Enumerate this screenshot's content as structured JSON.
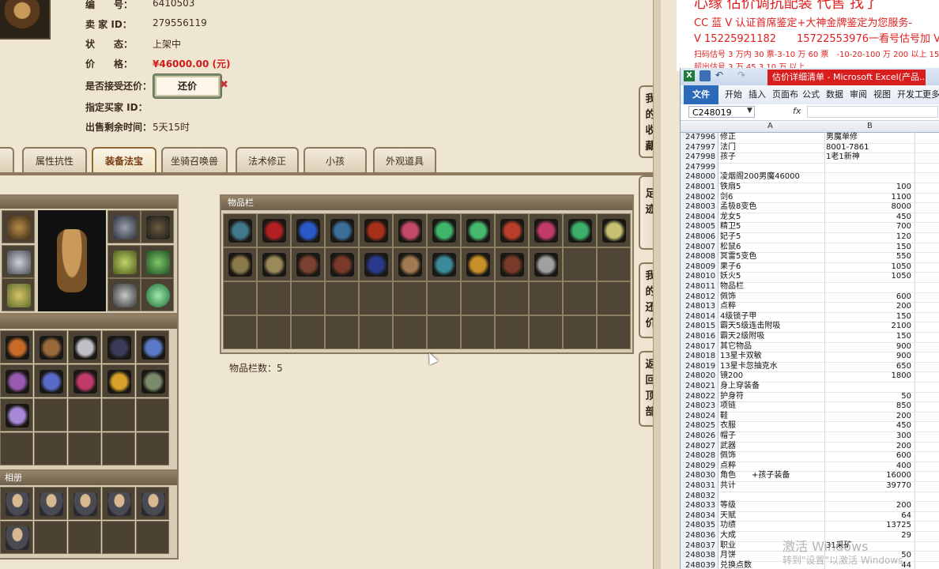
{
  "listing": {
    "id_label": "编　　号：",
    "id_value": "6410503",
    "seller_label": "卖 家 ID：",
    "seller_value": "279556119",
    "status_label": "状　　态：",
    "status_value": "上架中",
    "price_label": "价　　格：",
    "price_value": "¥46000.00 (元)",
    "counter_label": "是否接受还价：",
    "counter_button": "还价",
    "buyer_label": "指定买家 ID：",
    "remaining_label": "出售剩余时间：",
    "remaining_value": "5天15时"
  },
  "tabs": [
    "息",
    "属性抗性",
    "装备法宝",
    "坐骑召唤兽",
    "法术修正",
    "小孩",
    "外观道具"
  ],
  "active_tab": "装备法宝",
  "inventory": {
    "title": "物品栏",
    "count_label": "物品栏数：5"
  },
  "album_label": "相册",
  "side_tabs": [
    "我的收藏",
    "足迹",
    "我的还价",
    "返回顶部"
  ],
  "ad_text": {
    "line0": "心缘 估价调抗配装 代售 找了",
    "line1": "CC 蓝 V 认证首席鉴定+大神金牌鉴定为您服务-",
    "line2": "V 15225921182　　15722553976一看号估号加 V",
    "line3": "扫码估号 3 万内 30 票-3-10 万 60 票　-10-20-100 万 200 以上 150",
    "line4": "超出估号 3 万 45 3 10 万 以上"
  },
  "excel": {
    "title": "估价详细清单 - Microsoft Excel(产品...",
    "ribbon": [
      "文件",
      "开始",
      "插入",
      "页面布",
      "公式",
      "数据",
      "审阅",
      "视图",
      "开发工",
      "更多"
    ],
    "namebox": "C248019",
    "fx": "fx",
    "col_a": "A",
    "col_b": "B",
    "rows": [
      [
        "247996",
        "修正",
        "男魔单修"
      ],
      [
        "247997",
        "法门",
        "8001-7861"
      ],
      [
        "247998",
        "孩子",
        "1老1新神"
      ],
      [
        "247999",
        "",
        ""
      ],
      [
        "248000",
        "凌烟阁200男魔46000",
        ""
      ],
      [
        "248001",
        "铁扇5",
        "100"
      ],
      [
        "248002",
        "剑6",
        "1100"
      ],
      [
        "248003",
        "孟极8变色",
        "8000"
      ],
      [
        "248004",
        "龙女5",
        "450"
      ],
      [
        "248005",
        "精卫5",
        "700"
      ],
      [
        "248006",
        "妃子5",
        "120"
      ],
      [
        "248007",
        "松鼠6",
        "150"
      ],
      [
        "248008",
        "冥雷5变色",
        "550"
      ],
      [
        "248009",
        "果子6",
        "1050"
      ],
      [
        "248010",
        "妖火5",
        "1050"
      ],
      [
        "248011",
        "物品栏",
        ""
      ],
      [
        "248012",
        "佩饰",
        "600"
      ],
      [
        "248013",
        "点粹",
        "200"
      ],
      [
        "248014",
        "4级锁子甲",
        "150"
      ],
      [
        "248015",
        "霸天5级连击附吸",
        "2100"
      ],
      [
        "248016",
        "霸天2级附吸",
        "150"
      ],
      [
        "248017",
        "其它物品",
        "900"
      ],
      [
        "248018",
        "13星卡双敏",
        "900"
      ],
      [
        "248019",
        "13星卡忽抽克水",
        "650"
      ],
      [
        "248020",
        "镜200",
        "1800"
      ],
      [
        "248021",
        "身上穿装备",
        ""
      ],
      [
        "248022",
        "护身符",
        "50"
      ],
      [
        "248023",
        "项链",
        "850"
      ],
      [
        "248024",
        "鞋",
        "200"
      ],
      [
        "248025",
        "衣服",
        "450"
      ],
      [
        "248026",
        "帽子",
        "300"
      ],
      [
        "248027",
        "武器",
        "200"
      ],
      [
        "248028",
        "佩饰",
        "600"
      ],
      [
        "248029",
        "点粹",
        "400"
      ],
      [
        "248030",
        "角色　　+孩子装备",
        "16000"
      ],
      [
        "248031",
        "共计",
        "39770"
      ],
      [
        "248032",
        "",
        ""
      ],
      [
        "248033",
        "等级",
        "200"
      ],
      [
        "248034",
        "天赋",
        "64"
      ],
      [
        "248035",
        "功绩",
        "13725"
      ],
      [
        "248036",
        "大成",
        "29"
      ],
      [
        "248037",
        "职业",
        "31采矿"
      ],
      [
        "248038",
        "月饼",
        "50"
      ],
      [
        "248039",
        "兑换点数",
        "44"
      ]
    ]
  },
  "watermark": {
    "line1": "激活 Windows",
    "line2": "转到\"设置\"以激活 Windows。"
  },
  "colors": {
    "accent_red": "#d11a1a",
    "excel_blue": "#2a6ab8",
    "tab_active_text": "#7a3b10"
  }
}
